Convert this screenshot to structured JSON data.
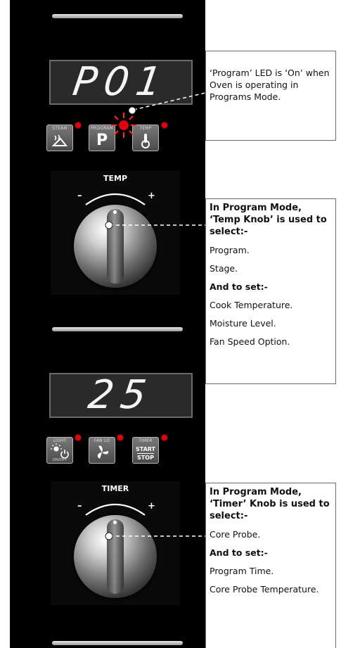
{
  "panel": {
    "display_top": "P01",
    "display_bottom": "25",
    "buttons_top": [
      {
        "label": "STEAM",
        "icon": "steam-icon"
      },
      {
        "label": "PROGRAM",
        "glyph": "P"
      },
      {
        "label": "TEMP",
        "icon": "thermometer-icon"
      }
    ],
    "buttons_bottom": [
      {
        "label": "LIGHT",
        "sub": "ON/OFF",
        "icon": "light-icon"
      },
      {
        "label": "FAN LO",
        "icon": "fan-icon"
      },
      {
        "label": "TIMER",
        "line1": "START",
        "line2": "STOP"
      }
    ],
    "knob_top_title": "TEMP",
    "knob_bottom_title": "TIMER",
    "minus": "–",
    "plus": "+"
  },
  "callouts": {
    "led": {
      "text": "‘Program’ LED is ‘On’ when Oven is operating in Programs Mode."
    },
    "temp": {
      "heading": "In Program Mode, ‘Temp Knob’ is used to select:-",
      "select_items": [
        "Program.",
        "Stage."
      ],
      "set_heading": "And to set:-",
      "set_items": [
        "Cook Temperature.",
        "Moisture Level.",
        "Fan Speed Option."
      ]
    },
    "timer": {
      "heading": "In Program Mode, ‘Timer’ Knob is used to select:-",
      "select_items": [
        "Core Probe."
      ],
      "set_heading": "And to set:-",
      "set_items": [
        "Program Time.",
        "Core Probe Temperature."
      ]
    }
  },
  "colors": {
    "led_red": "#e00010",
    "panel": "#000000",
    "display": "#2a2a2a"
  }
}
